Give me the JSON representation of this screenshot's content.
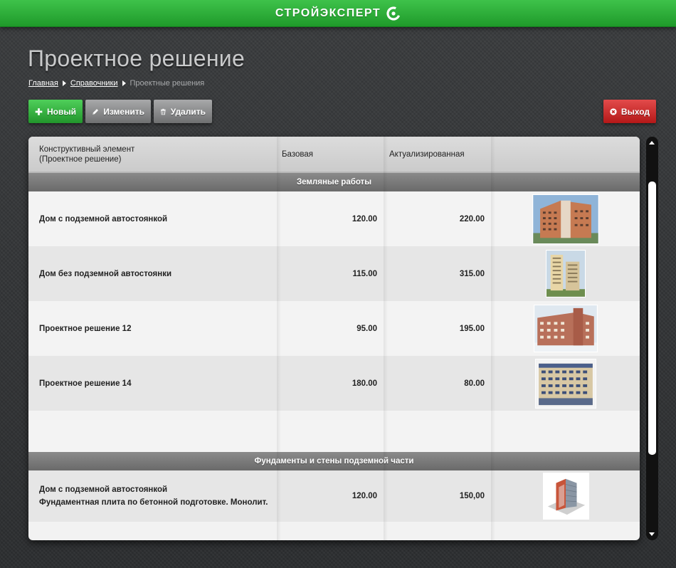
{
  "header": {
    "brand": "СТРОЙЭКСПЕРТ",
    "brand_logo": "c-logo-icon"
  },
  "page": {
    "title": "Проектное решение"
  },
  "breadcrumb": {
    "items": [
      "Главная",
      "Справочники",
      "Проектные решения"
    ]
  },
  "toolbar": {
    "new_label": "Новый",
    "edit_label": "Изменить",
    "delete_label": "Удалить",
    "exit_label": "Выход"
  },
  "table": {
    "columns": [
      "Конструктивный элемент\n(Проектное решение)",
      "Базовая",
      "Актуализированная",
      ""
    ],
    "groups": [
      {
        "title": "Земляные работы",
        "rows": [
          {
            "name": "Дом с подземной автостоянкой",
            "name2": "",
            "base": "120.00",
            "actual": "220.00",
            "image": "building-photo-icon"
          },
          {
            "name": "Дом без подземной автостоянки",
            "name2": "",
            "base": "115.00",
            "actual": "315.00",
            "image": "building-photo-icon"
          },
          {
            "name": "Проектное решение 12",
            "name2": "",
            "base": "95.00",
            "actual": "195.00",
            "image": "building-photo-icon"
          },
          {
            "name": "Проектное решение 14",
            "name2": "",
            "base": "180.00",
            "actual": "80.00",
            "image": "building-photo-icon"
          }
        ]
      },
      {
        "title": "Фундаменты и стены подземной части",
        "rows": [
          {
            "name": "Дом с подземной автостоянкой",
            "name2": "Фундаментная плита по бетонной подготовке. Монолит.",
            "base": "120.00",
            "actual": "150,00",
            "image": "building-render-icon"
          }
        ]
      }
    ]
  },
  "colors": {
    "accent_green": "#22962c",
    "exit_red": "#b41818",
    "group_header": "#6a6a6a"
  }
}
